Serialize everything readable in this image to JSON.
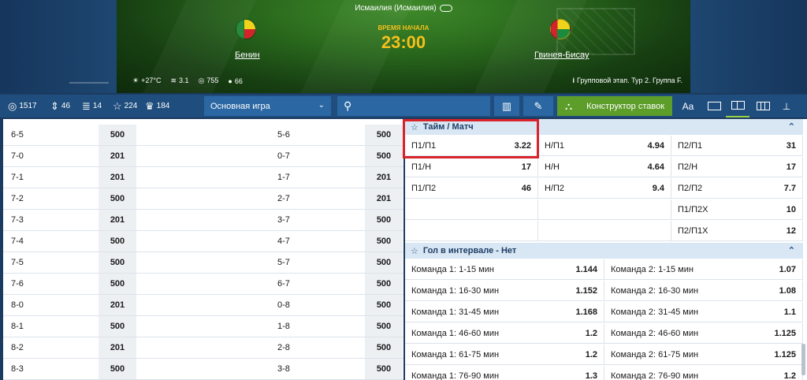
{
  "match": {
    "venue": "Исмаилия (Исмаилия)",
    "start_label": "ВРЕМЯ НАЧАЛА",
    "start_time": "23:00",
    "team1": "Бенин",
    "team2": "Гвинея-Бисау",
    "temperature": "+27°C",
    "wind": "3.1",
    "pressure": "755",
    "humidity": "66",
    "stage": "Групповой этап. Тур 2. Группа F."
  },
  "toolbar": {
    "count_all": "1517",
    "count_2": "46",
    "count_3": "14",
    "count_fav": "224",
    "count_5": "184",
    "select_value": "Основная игра",
    "builder_label": "Конструктор ставок",
    "font_btn": "Aa"
  },
  "left_rows": [
    {
      "c1": "6-5",
      "v1": "500",
      "c2": "5-6",
      "v2": "500"
    },
    {
      "c1": "7-0",
      "v1": "201",
      "c2": "0-7",
      "v2": "500"
    },
    {
      "c1": "7-1",
      "v1": "201",
      "c2": "1-7",
      "v2": "201"
    },
    {
      "c1": "7-2",
      "v1": "500",
      "c2": "2-7",
      "v2": "201"
    },
    {
      "c1": "7-3",
      "v1": "201",
      "c2": "3-7",
      "v2": "500"
    },
    {
      "c1": "7-4",
      "v1": "500",
      "c2": "4-7",
      "v2": "500"
    },
    {
      "c1": "7-5",
      "v1": "500",
      "c2": "5-7",
      "v2": "500"
    },
    {
      "c1": "7-6",
      "v1": "500",
      "c2": "6-7",
      "v2": "500"
    },
    {
      "c1": "8-0",
      "v1": "201",
      "c2": "0-8",
      "v2": "500"
    },
    {
      "c1": "8-1",
      "v1": "500",
      "c2": "1-8",
      "v2": "500"
    },
    {
      "c1": "8-2",
      "v1": "201",
      "c2": "2-8",
      "v2": "500"
    },
    {
      "c1": "8-3",
      "v1": "500",
      "c2": "3-8",
      "v2": "500"
    }
  ],
  "ht_ft": {
    "title": "Тайм / Матч",
    "rows": [
      [
        {
          "l": "П1/П1",
          "v": "3.22"
        },
        {
          "l": "Н/П1",
          "v": "4.94"
        },
        {
          "l": "П2/П1",
          "v": "31"
        }
      ],
      [
        {
          "l": "П1/Н",
          "v": "17"
        },
        {
          "l": "Н/Н",
          "v": "4.64"
        },
        {
          "l": "П2/Н",
          "v": "17"
        }
      ],
      [
        {
          "l": "П1/П2",
          "v": "46"
        },
        {
          "l": "Н/П2",
          "v": "9.4"
        },
        {
          "l": "П2/П2",
          "v": "7.7"
        }
      ],
      [
        {
          "l": "",
          "v": ""
        },
        {
          "l": "",
          "v": ""
        },
        {
          "l": "П1/П2Х",
          "v": "10"
        }
      ],
      [
        {
          "l": "",
          "v": ""
        },
        {
          "l": "",
          "v": ""
        },
        {
          "l": "П2/П1Х",
          "v": "12"
        }
      ]
    ]
  },
  "goal_interval": {
    "title": "Гол в интервале - Нет",
    "rows": [
      [
        {
          "l": "Команда 1: 1-15 мин",
          "v": "1.144"
        },
        {
          "l": "Команда 2: 1-15 мин",
          "v": "1.07"
        }
      ],
      [
        {
          "l": "Команда 1: 16-30 мин",
          "v": "1.152"
        },
        {
          "l": "Команда 2: 16-30 мин",
          "v": "1.08"
        }
      ],
      [
        {
          "l": "Команда 1: 31-45 мин",
          "v": "1.168"
        },
        {
          "l": "Команда 2: 31-45 мин",
          "v": "1.1"
        }
      ],
      [
        {
          "l": "Команда 1: 46-60 мин",
          "v": "1.2"
        },
        {
          "l": "Команда 2: 46-60 мин",
          "v": "1.125"
        }
      ],
      [
        {
          "l": "Команда 1: 61-75 мин",
          "v": "1.2"
        },
        {
          "l": "Команда 2: 61-75 мин",
          "v": "1.125"
        }
      ],
      [
        {
          "l": "Команда 1: 76-90 мин",
          "v": "1.3"
        },
        {
          "l": "Команда 2: 76-90 мин",
          "v": "1.2"
        }
      ]
    ]
  },
  "icons": [
    "target-icon",
    "up-down-icon",
    "bars-icon",
    "star-icon",
    "trophy-icon",
    "chevron-down-icon",
    "search-icon",
    "book-icon",
    "stats-icon",
    "builder-icon",
    "layout-icon"
  ],
  "colors": {
    "accent_green": "#5d9d2a",
    "toolbar": "#1f4d7d",
    "time": "#f5c01b",
    "highlight": "#d8232a"
  }
}
